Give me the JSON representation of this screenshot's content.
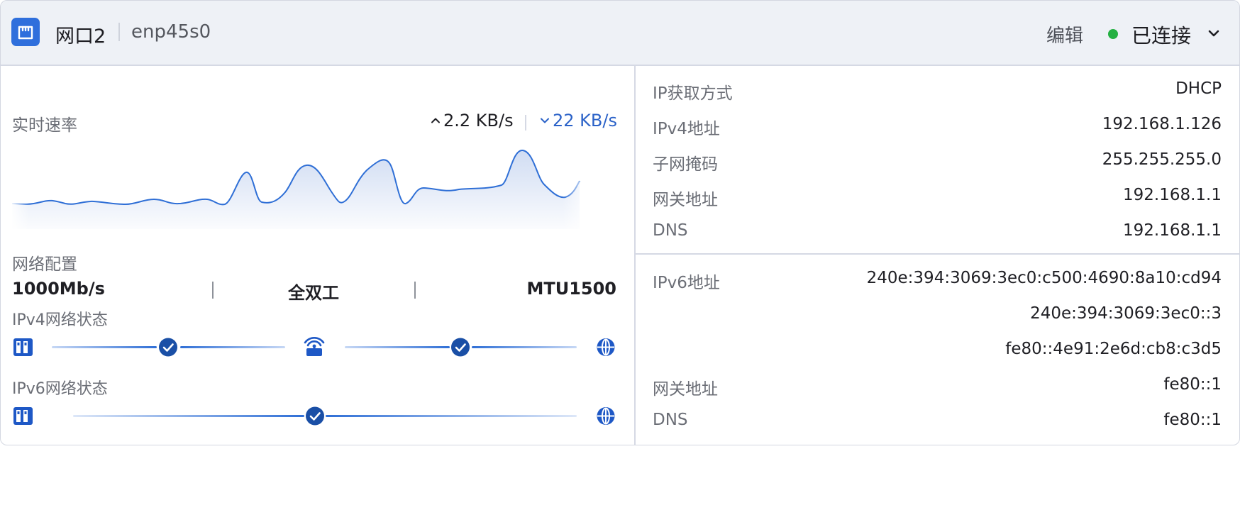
{
  "header": {
    "port_name": "网口2",
    "device_name": "enp45s0",
    "edit_label": "编辑",
    "status_text": "已连接",
    "status_color": "#24b042",
    "icon": "ethernet-port-icon",
    "dropdown_icon": "chevron-down-icon"
  },
  "speed": {
    "label": "实时速率",
    "upload": "2.2 KB/s",
    "download": "22 KB/s",
    "upload_icon": "arrow-up-icon",
    "download_icon": "arrow-down-icon",
    "accent_color": "#2b62c8"
  },
  "network_config": {
    "label": "网络配置",
    "speed": "1000Mb/s",
    "duplex": "全双工",
    "mtu": "MTU1500"
  },
  "ipv4_status": {
    "label": "IPv4网络状态",
    "nodes": [
      "device-icon",
      "check-icon",
      "router-icon",
      "check-icon",
      "globe-icon"
    ]
  },
  "ipv6_status": {
    "label": "IPv6网络状态",
    "nodes": [
      "device-icon",
      "check-icon",
      "globe-icon"
    ]
  },
  "ipv4_info": [
    {
      "key": "IP获取方式",
      "value": "DHCP"
    },
    {
      "key": "IPv4地址",
      "value": "192.168.1.126"
    },
    {
      "key": "子网掩码",
      "value": "255.255.255.0"
    },
    {
      "key": "网关地址",
      "value": "192.168.1.1"
    },
    {
      "key": "DNS",
      "value": "192.168.1.1"
    }
  ],
  "ipv6_info": [
    {
      "key": "IPv6地址",
      "value": "240e:394:3069:3ec0:c500:4690:8a10:cd94"
    },
    {
      "key": "",
      "value": "240e:394:3069:3ec0::3"
    },
    {
      "key": "",
      "value": "fe80::4e91:2e6d:cb8:c3d5"
    },
    {
      "key": "网关地址",
      "value": "fe80::1"
    },
    {
      "key": "DNS",
      "value": "fe80::1"
    }
  ]
}
